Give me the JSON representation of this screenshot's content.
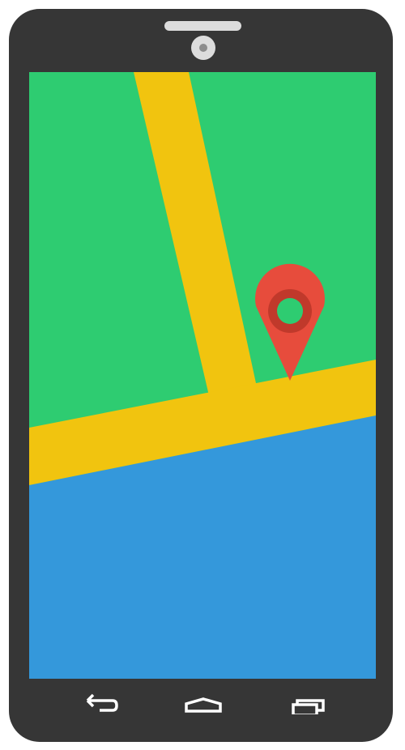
{
  "colors": {
    "phone_body": "#363636",
    "phone_detail": "#dcdcdc",
    "park": "#2ecc71",
    "road": "#f1c40f",
    "water": "#3498db",
    "pin": "#e74c3c",
    "pin_ring": "#c0392b",
    "nav_icon": "#ffffff"
  },
  "screen": {
    "content": "map",
    "regions": [
      "park",
      "road",
      "water"
    ],
    "marker_icon": "map-pin-icon"
  },
  "nav_bar": {
    "buttons": [
      {
        "name": "back-button",
        "icon": "back-arrow-icon"
      },
      {
        "name": "home-button",
        "icon": "home-icon"
      },
      {
        "name": "recent-apps-button",
        "icon": "recent-apps-icon"
      }
    ]
  }
}
